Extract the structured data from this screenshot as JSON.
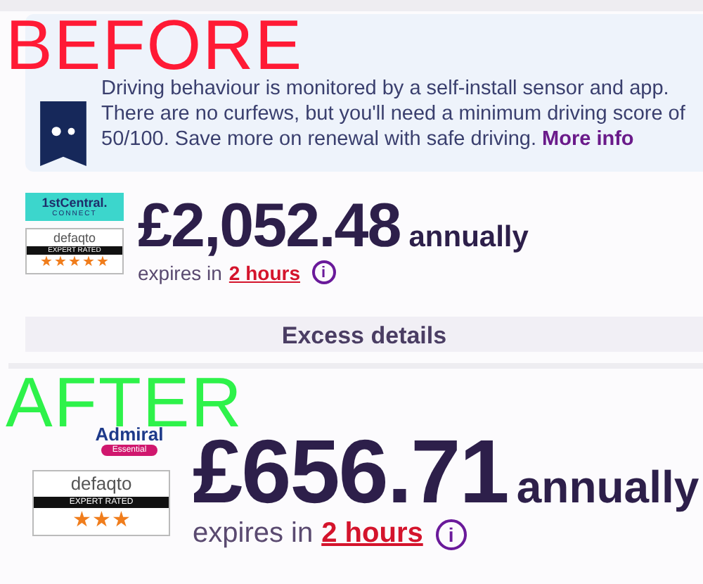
{
  "overlay_labels": [
    {
      "text": "BEFORE",
      "kind": "before"
    },
    {
      "text": "AFTER",
      "kind": "after"
    }
  ],
  "before": {
    "telematics": {
      "text": "Driving behaviour is monitored by a self-install sensor and app. There are no curfews, but you'll need a minimum driving score of 50/100. Save more on renewal with safe driving.",
      "link": "More info"
    },
    "quote": {
      "brand": {
        "kind": "firstcentral",
        "name": "1stCentral.",
        "sub": "CONNECT"
      },
      "rating": {
        "name": "defaqto",
        "label": "EXPERT RATED",
        "stars": 5
      },
      "price": "£2,052.48",
      "period": "annually",
      "expires_prefix": "expires in",
      "expires_link": "2 hours",
      "info": "i"
    },
    "excess_button": "Excess details"
  },
  "after": {
    "quote": {
      "brand": {
        "kind": "admiral",
        "name": "Admiral",
        "sub": "Essential"
      },
      "rating": {
        "name": "defaqto",
        "label": "EXPERT RATED",
        "stars": 3
      },
      "price": "£656.71",
      "period": "annually",
      "expires_prefix": "expires in",
      "expires_link": "2 hours",
      "info": "i"
    }
  }
}
